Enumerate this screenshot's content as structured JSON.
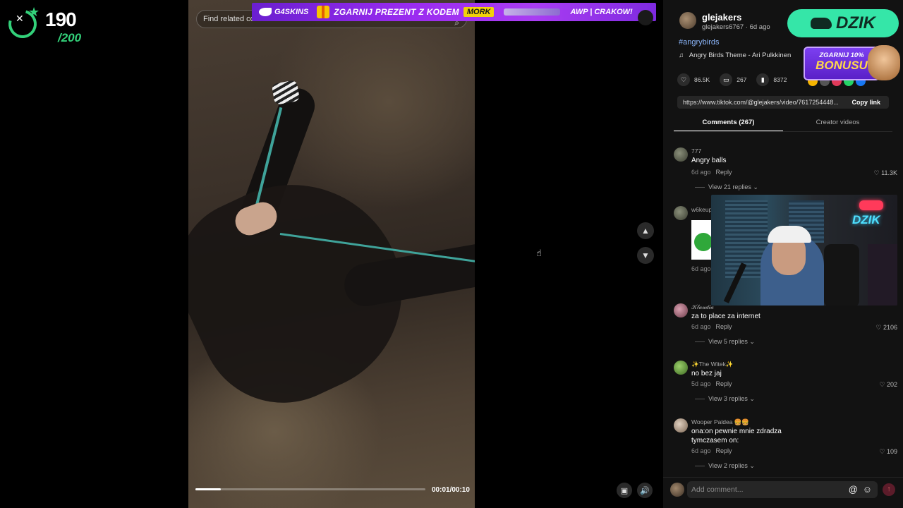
{
  "overlay": {
    "count": "190",
    "total": "/200"
  },
  "video": {
    "search_placeholder": "Find related content",
    "time": "00:01/00:10",
    "progress_fraction": 0.11
  },
  "banner": {
    "brand": "G4SKINS",
    "promo": "ZGARNIJ PREZENT Z KODEM",
    "code": "MORK",
    "tail": "AWP | CRAKOW!"
  },
  "post": {
    "author": "glejakers",
    "meta": "glejakers6767 · 6d ago",
    "hashtag": "#angrybirds",
    "music": "Angry Birds Theme - Ari Pulkkinen",
    "likes": "86.5K",
    "comments": "267",
    "saves": "8372",
    "link": "https://www.tiktok.com/@glejakers/video/7617254448...",
    "copy_label": "Copy link"
  },
  "tabs": {
    "comments": "Comments (267)",
    "creator": "Creator videos"
  },
  "comments": [
    {
      "user": "777",
      "text": "Angry balls",
      "time": "6d ago",
      "reply": "Reply",
      "likes": "11.3K",
      "view": "View 21 replies"
    },
    {
      "user": "w6keup",
      "text": "",
      "time": "6d ago",
      "reply": "",
      "likes": "",
      "view": ""
    },
    {
      "user": "𝒦𝓁𝒶𝓊𝒹𝒾𝒶",
      "text": "za to place za internet",
      "time": "6d ago",
      "reply": "Reply",
      "likes": "2106",
      "view": "View 5 replies"
    },
    {
      "user": "✨The Witek✨",
      "text": "no bez jaj",
      "time": "5d ago",
      "reply": "Reply",
      "likes": "202",
      "view": "View 3 replies"
    },
    {
      "user": "Wooper Paldea 🍔🍔",
      "text": "ona:on pewnie mnie zdradza\ntymczasem on:",
      "time": "6d ago",
      "reply": "Reply",
      "likes": "109",
      "view": "View 2 replies"
    }
  ],
  "sponsor": {
    "dzik": "DZIK",
    "bonus_line1": "ZGARNIJ 10%",
    "bonus_line2": "BONUSU",
    "cam_neon": "DZIK"
  },
  "composer": {
    "placeholder": "Add comment..."
  },
  "icons": {
    "heart": "♡",
    "comment": "💬",
    "save": "🔖",
    "music": "♫",
    "up": "▲",
    "down": "▼"
  },
  "colors": {
    "accent_green": "#33d17a",
    "dzik_green": "#35e6a8",
    "banner_purple": "#9b2cf0",
    "link_blue": "#8ab4f8"
  }
}
